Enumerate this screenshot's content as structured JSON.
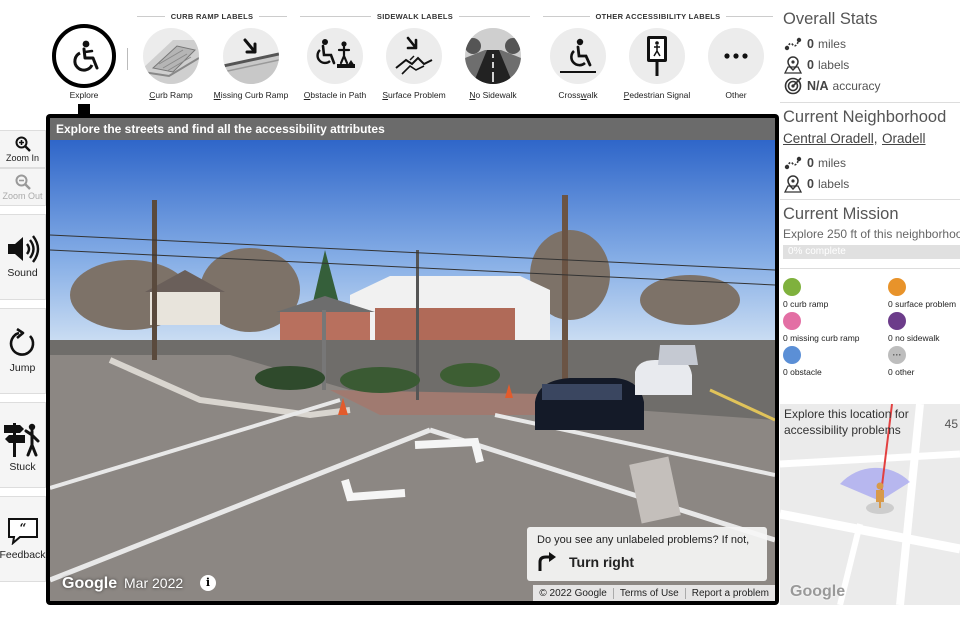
{
  "toolbar": {
    "groups": {
      "curb_ramp": "CURB RAMP LABELS",
      "sidewalk": "SIDEWALK LABELS",
      "other": "OTHER ACCESSIBILITY LABELS"
    },
    "explore": {
      "label": "Explore",
      "icon": "wheelchair-user-icon"
    },
    "tools": [
      {
        "id": "curb-ramp",
        "key": "C",
        "rest": "urb Ramp",
        "icon": "curb-ramp-icon"
      },
      {
        "id": "missing-curb-ramp",
        "key": "M",
        "rest": "issing Curb Ramp",
        "icon": "missing-curb-ramp-icon"
      },
      {
        "id": "obstacle",
        "key": "O",
        "rest": "bstacle in Path",
        "icon": "obstacle-icon"
      },
      {
        "id": "surface-problem",
        "key": "S",
        "rest": "urface Problem",
        "icon": "surface-problem-icon"
      },
      {
        "id": "no-sidewalk",
        "key": "N",
        "rest": "o Sidewalk",
        "icon": "no-sidewalk-icon"
      },
      {
        "id": "crosswalk",
        "pre": "Cross",
        "key": "w",
        "rest": "alk",
        "icon": "crosswalk-icon"
      },
      {
        "id": "pedestrian-signal",
        "key": "P",
        "rest": "edestrian Signal",
        "icon": "pedestrian-signal-icon"
      },
      {
        "id": "other",
        "label": "Other",
        "icon": "more-icon"
      }
    ]
  },
  "nav": {
    "zoom_in": "Zoom In",
    "zoom_out": "Zoom Out",
    "sound": "Sound",
    "jump": "Jump",
    "stuck": "Stuck",
    "feedback": "Feedback"
  },
  "pano": {
    "title": "Explore the streets and find all the accessibility attributes",
    "google": "Google",
    "date": "Mar 2022",
    "info": "i",
    "footer": [
      "© 2022 Google",
      "Terms of Use",
      "Report a problem"
    ],
    "prompt_question": "Do you see any unlabeled problems? If not,",
    "prompt_action": "Turn right"
  },
  "overall_stats": {
    "title": "Overall Stats",
    "miles_value": "0",
    "miles_unit": "miles",
    "labels_value": "0",
    "labels_unit": "labels",
    "accuracy_value": "N/A",
    "accuracy_unit": "accuracy"
  },
  "neighborhood": {
    "title": "Current Neighborhood",
    "name_part1": "Central Oradell,",
    "name_part2": "Oradell",
    "miles_value": "0",
    "miles_unit": "miles",
    "labels_value": "0",
    "labels_unit": "labels"
  },
  "mission": {
    "title": "Current Mission",
    "description": "Explore 250 ft of this neighborhood",
    "progress_text": "0% complete",
    "progress": 0
  },
  "label_counts": [
    {
      "id": "curb-ramp",
      "text": "0 curb ramp",
      "color": "#7fb13d"
    },
    {
      "id": "surface-problem",
      "text": "0 surface problem",
      "color": "#e8932a"
    },
    {
      "id": "missing-curb-ramp",
      "text": "0 missing curb ramp",
      "color": "#e36fa4"
    },
    {
      "id": "no-sidewalk",
      "text": "0 no sidewalk",
      "color": "#6c3c8a"
    },
    {
      "id": "obstacle",
      "text": "0 obstacle",
      "color": "#5b8fd6"
    },
    {
      "id": "other",
      "text": "0 other",
      "color": "#bdbdbd"
    }
  ],
  "minimap": {
    "text_line1": "Explore this location for",
    "text_line2": "accessibility problems",
    "number": "45",
    "google": "Google"
  }
}
